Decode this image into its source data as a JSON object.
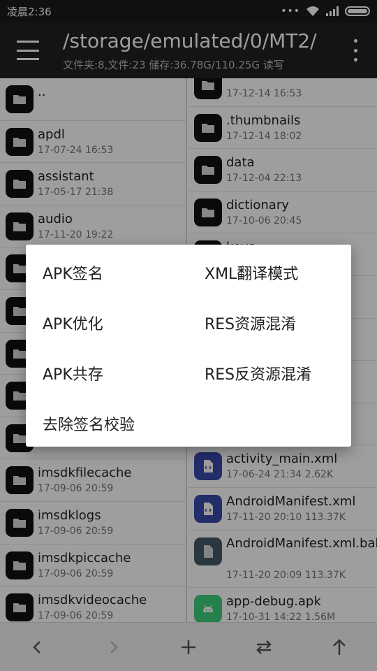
{
  "status_bar": {
    "time": "凌晨2:36"
  },
  "toolbar": {
    "path": "/storage/emulated/0/MT2/",
    "info": "文件夹:8,文件:23  储存:36.78G/110.25G  读写"
  },
  "left_pane": {
    "items": [
      {
        "name": "..",
        "meta": ""
      },
      {
        "name": "apdl",
        "meta": "17-07-24 16:53"
      },
      {
        "name": "assistant",
        "meta": "17-05-17 21:38"
      },
      {
        "name": "audio",
        "meta": "17-11-20 19:22"
      },
      {
        "name": "",
        "meta": ""
      },
      {
        "name": "",
        "meta": ""
      },
      {
        "name": "",
        "meta": ""
      },
      {
        "name": "",
        "meta": ""
      },
      {
        "name": "",
        "meta": ""
      },
      {
        "name": "imsdkfilecache",
        "meta": "17-09-06 20:59"
      },
      {
        "name": "imsdklogs",
        "meta": "17-09-06 20:59"
      },
      {
        "name": "imsdkpiccache",
        "meta": "17-09-06 20:59"
      },
      {
        "name": "imsdkvideocache",
        "meta": "17-09-06 20:59"
      }
    ]
  },
  "right_pane": {
    "items": [
      {
        "name": "",
        "meta": "17-12-14 16:53",
        "icon": "folder"
      },
      {
        "name": ".thumbnails",
        "meta": "17-12-14 18:02",
        "icon": "folder"
      },
      {
        "name": "data",
        "meta": "17-12-04 22:13",
        "icon": "folder"
      },
      {
        "name": "dictionary",
        "meta": "17-10-06 20:45",
        "icon": "folder"
      },
      {
        "name": "keys",
        "meta": "",
        "icon": "folder"
      },
      {
        "name": "",
        "meta": "",
        "icon": "folder"
      },
      {
        "name": "",
        "meta": "",
        "icon": "folder"
      },
      {
        "name": "",
        "meta": "",
        "icon": "folder"
      },
      {
        "name": "",
        "meta": "",
        "icon": "folder"
      },
      {
        "name": "activity_main.xml",
        "meta": "17-06-24 21:34  2.62K",
        "icon": "xml"
      },
      {
        "name": "AndroidManifest.xml",
        "meta": "17-11-20 20:10  113.37K",
        "icon": "xml"
      },
      {
        "name": "AndroidManifest.xml.bak",
        "meta": "17-11-20 20:09  113.37K",
        "icon": "bak"
      },
      {
        "name": "app-debug.apk",
        "meta": "17-10-31 14:22  1.56M",
        "icon": "apk"
      }
    ]
  },
  "dialog": {
    "items": [
      "APK签名",
      "XML翻译模式",
      "APK优化",
      "RES资源混淆",
      "APK共存",
      "RES反资源混淆",
      "去除签名校验"
    ]
  },
  "bottom_bar": {
    "icons": [
      "back-arrow-icon",
      "forward-arrow-icon",
      "add-icon",
      "swap-icon",
      "up-arrow-icon"
    ]
  }
}
